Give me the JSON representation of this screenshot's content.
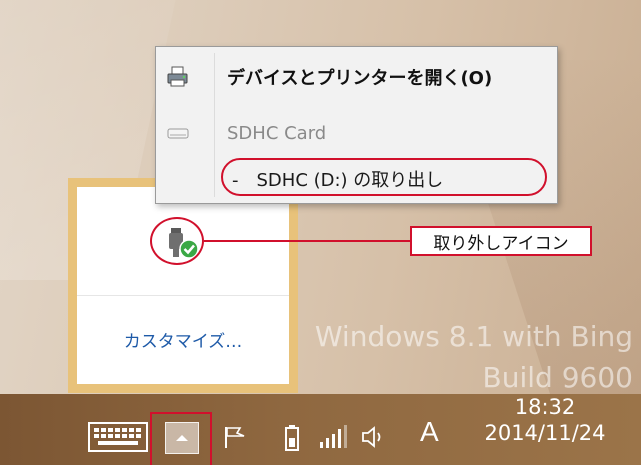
{
  "menu": {
    "open_devices_label": "デバイスとプリンターを開く(O)",
    "card_label": "SDHC Card",
    "eject_label": "-　SDHC (D:) の取り出し"
  },
  "tray": {
    "customize_label": "カスタマイズ…",
    "safe_remove_icon": "usb-safe-remove-icon"
  },
  "callout": {
    "label": "取り外しアイコン"
  },
  "watermark": {
    "line1": "Windows 8.1 with Bing",
    "line2": "Build 9600"
  },
  "taskbar": {
    "ime_indicator": "A",
    "time": "18:32",
    "date": "2014/11/24"
  },
  "colors": {
    "highlight": "#d1102c",
    "flyout_border": "#e8c27a",
    "link": "#1e5aa8"
  }
}
